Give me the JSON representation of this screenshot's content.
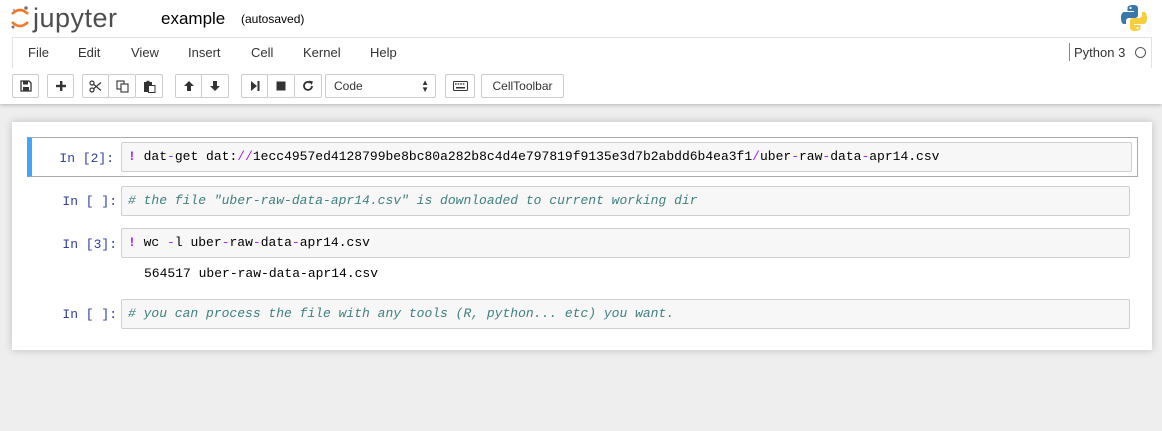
{
  "header": {
    "logo_text": "jupyter",
    "notebook_name": "example",
    "autosave_status": "(autosaved)"
  },
  "menu": {
    "items": [
      "File",
      "Edit",
      "View",
      "Insert",
      "Cell",
      "Kernel",
      "Help"
    ]
  },
  "kernel": {
    "name": "Python 3"
  },
  "toolbar": {
    "cell_type": "Code",
    "celltoolbar_label": "CellToolbar"
  },
  "cells": [
    {
      "prompt": "In [2]:",
      "bang": "!",
      "code_parts": [
        "dat",
        "-",
        "get dat:",
        "//",
        "1ecc4957ed4128799be8bc80a282b8c4d4e797819f9135e3d7b2abdd6b4ea3f1",
        "/",
        "uber",
        "-",
        "raw",
        "-",
        "data",
        "-",
        "apr14.csv"
      ]
    },
    {
      "prompt": "In [ ]:",
      "comment": "# the file \"uber-raw-data-apr14.csv\" is downloaded to current working dir"
    },
    {
      "prompt": "In [3]:",
      "bang": "!",
      "code_parts": [
        "wc ",
        "-",
        "l uber",
        "-",
        "raw",
        "-",
        "data",
        "-",
        "apr14.csv"
      ],
      "output": "564517 uber-raw-data-apr14.csv"
    },
    {
      "prompt": "In [ ]:",
      "comment": "# you can process the file with any tools (R, python... etc) you want."
    }
  ]
}
